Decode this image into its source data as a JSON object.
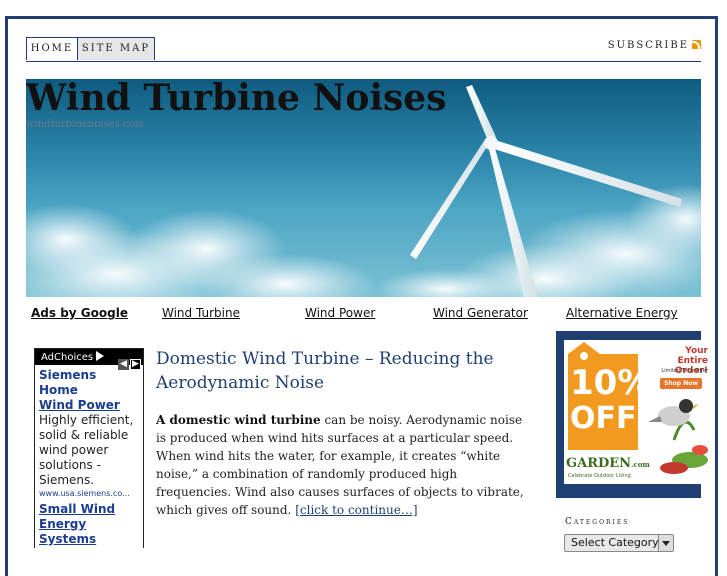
{
  "nav": {
    "home": "Home",
    "sitemap": "Site Map",
    "subscribe": "Subscribe"
  },
  "header": {
    "title": "Wind Turbine Noises",
    "subtitle": "windturbinenoises.com"
  },
  "linkrow": {
    "ads_by": "Ads by Google",
    "links": [
      "Wind Turbine",
      "Wind Power",
      "Wind Generator",
      "Alternative Energy"
    ]
  },
  "left_ad": {
    "adchoices": "AdChoices",
    "ad1_title_line1": "Siemens Home",
    "ad1_title_line2": "Wind Power",
    "ad1_text": "Highly efficient, solid & reliable wind power solutions - Siemens.",
    "ad1_url": "www.usa.siemens.co...",
    "ad2_title": "Small Wind Energy Systems"
  },
  "post": {
    "title": "Domestic Wind Turbine – Reducing the Aerodynamic Noise",
    "lead_bold": "A domestic wind turbine",
    "body": " can be noisy. Aerodynamic noise is produced when wind hits surfaces at a particular speed. When wind hits the water, for example, it creates “white noise,” a combination of randomly produced high frequencies. Wind also causes surfaces of objects to vibrate, which gives off sound. ",
    "more": "[click to continue…]"
  },
  "right_ad": {
    "headline": "Your Entire Order!",
    "limited": "Limited Time Offer",
    "shop": "Shop Now",
    "percent": "10%",
    "off": "OFF",
    "brand": "GARDEN",
    "brand_suffix": ".com",
    "tagline": "Celebrate Outdoor Living"
  },
  "sidebar": {
    "categories_heading": "Categories",
    "select_value": "Select Category"
  },
  "colors": {
    "navy": "#1f3f72",
    "orange": "#f39200"
  }
}
